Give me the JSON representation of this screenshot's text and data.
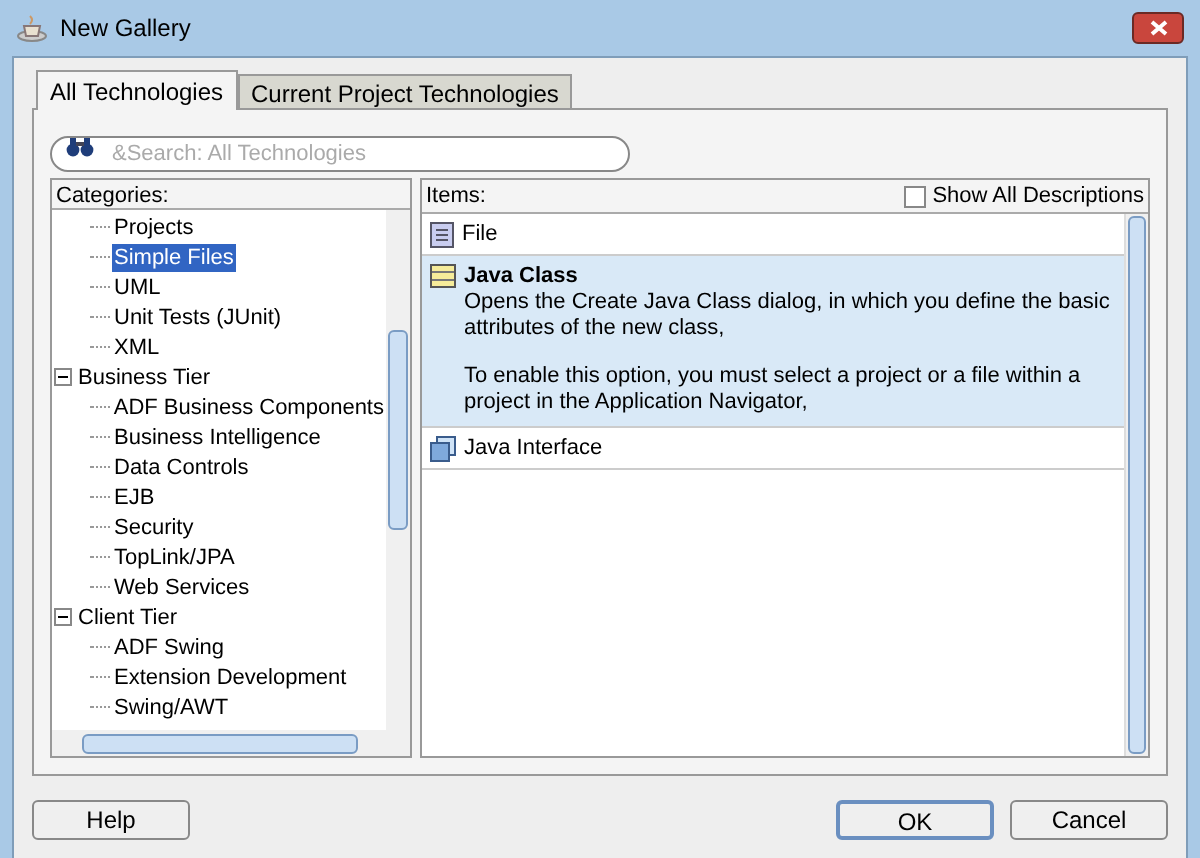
{
  "window": {
    "title": "New Gallery"
  },
  "tabs": [
    {
      "label": "All Technologies",
      "selected": true
    },
    {
      "label": "Current Project Technologies",
      "selected": false
    }
  ],
  "search": {
    "placeholder": "&Search: All Technologies"
  },
  "categories": {
    "label": "Categories:",
    "nodes": [
      {
        "children": [
          {
            "label": "Projects",
            "selected": false
          },
          {
            "label": "Simple Files",
            "selected": true
          },
          {
            "label": "UML",
            "selected": false
          },
          {
            "label": "Unit Tests (JUnit)",
            "selected": false
          },
          {
            "label": "XML",
            "selected": false
          }
        ]
      },
      {
        "label": "Business Tier",
        "expanded": true,
        "children": [
          {
            "label": "ADF Business Components",
            "selected": false
          },
          {
            "label": "Business Intelligence",
            "selected": false
          },
          {
            "label": "Data Controls",
            "selected": false
          },
          {
            "label": "EJB",
            "selected": false
          },
          {
            "label": "Security",
            "selected": false
          },
          {
            "label": "TopLink/JPA",
            "selected": false
          },
          {
            "label": "Web Services",
            "selected": false
          }
        ]
      },
      {
        "label": "Client Tier",
        "expanded": true,
        "children": [
          {
            "label": "ADF Swing",
            "selected": false
          },
          {
            "label": "Extension Development",
            "selected": false
          },
          {
            "label": "Swing/AWT",
            "selected": false
          }
        ]
      }
    ]
  },
  "items": {
    "label": "Items:",
    "show_all": {
      "label": "Show All Descriptions",
      "checked": false
    },
    "list": [
      {
        "kind": "file",
        "label": "File",
        "selected": false
      },
      {
        "kind": "class",
        "label": "Java Class",
        "selected": true,
        "description": [
          "Opens the Create Java Class dialog, in which you define the basic attributes of the new class,",
          "To enable this option, you must select a project or a file within a project in the Application Navigator,"
        ]
      },
      {
        "kind": "interface",
        "label": "Java Interface",
        "selected": false
      }
    ]
  },
  "buttons": {
    "help": "Help",
    "ok": "OK",
    "cancel": "Cancel"
  }
}
